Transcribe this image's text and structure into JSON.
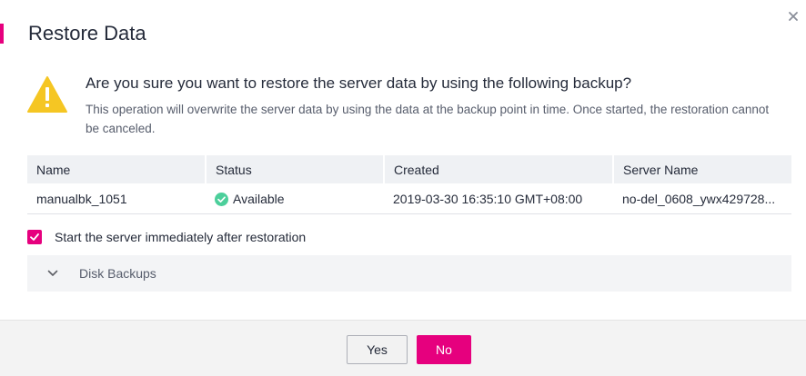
{
  "dialog": {
    "title": "Restore Data",
    "question": "Are you sure you want to restore the server data by using the following backup?",
    "description": "This operation will overwrite the server data by using the data at the backup point in time. Once started, the restoration cannot be canceled."
  },
  "table": {
    "headers": [
      "Name",
      "Status",
      "Created",
      "Server Name"
    ],
    "rows": [
      {
        "name": "manualbk_1051",
        "status": "Available",
        "created": "2019-03-30 16:35:10 GMT+08:00",
        "server_name": "no-del_0608_ywx429728..."
      }
    ]
  },
  "options": {
    "start_server_label": "Start the server immediately after restoration",
    "start_server_checked": true
  },
  "disk_backups": {
    "label": "Disk Backups",
    "expanded": false
  },
  "buttons": {
    "yes": "Yes",
    "no": "No"
  },
  "colors": {
    "accent": "#e6007e",
    "warning": "#f5c623",
    "success": "#4ccf9b"
  }
}
